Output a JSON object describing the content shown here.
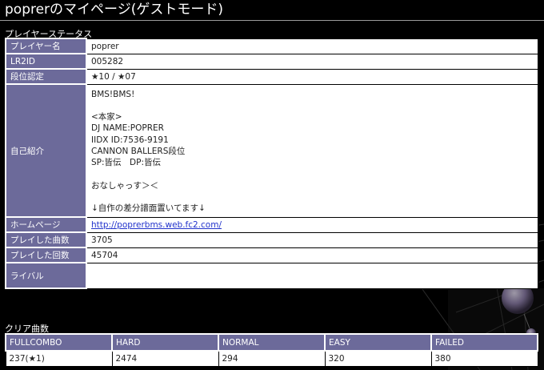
{
  "page": {
    "title": "poprerのマイページ(ゲストモード)"
  },
  "player_status": {
    "heading": "プレイヤーステータス",
    "rows": [
      {
        "label": "プレイヤー名",
        "value": "poprer"
      },
      {
        "label": "LR2ID",
        "value": "005282"
      },
      {
        "label": "段位認定",
        "value": "★10 / ★07"
      },
      {
        "label": "自己紹介",
        "value": "BMS!BMS!\n\n<本家>\nDJ NAME:POPRER\nIIDX ID:7536-9191\nCANNON BALLERS段位\nSP:皆伝　DP:皆伝\n\nおなしゃっす＞＜\n\n↓自作の差分譜面置いてます↓"
      },
      {
        "label": "ホームページ",
        "value": "http://poprerbms.web.fc2.com/"
      },
      {
        "label": "プレイした曲数",
        "value": "3705"
      },
      {
        "label": "プレイした回数",
        "value": "45704"
      },
      {
        "label": "ライバル",
        "value": ""
      }
    ]
  },
  "clear": {
    "heading": "クリア曲数",
    "headers": [
      "FULLCOMBO",
      "HARD",
      "NORMAL",
      "EASY",
      "FAILED"
    ],
    "values": [
      "237(★1)",
      "2474",
      "294",
      "320",
      "380"
    ]
  }
}
